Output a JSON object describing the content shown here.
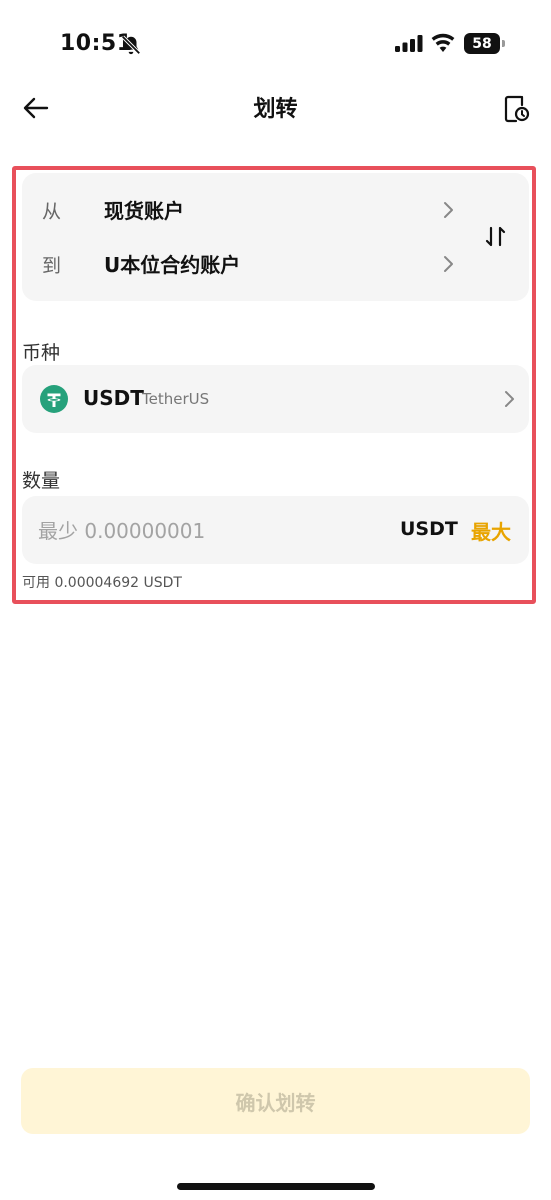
{
  "status_bar": {
    "time": "10:51",
    "battery_level": "58"
  },
  "nav": {
    "title": "划转",
    "back_icon": "arrow-left-icon",
    "history_icon": "transfer-history-icon"
  },
  "transfer": {
    "from_label": "从",
    "from_account": "现货账户",
    "to_label": "到",
    "to_account": "U本位合约账户",
    "swap_icon": "swap-vertical-icon"
  },
  "coin": {
    "section_label": "币种",
    "symbol": "USDT",
    "name": "TetherUS",
    "icon": "tether-icon"
  },
  "amount": {
    "section_label": "数量",
    "placeholder": "最少 0.00000001",
    "unit": "USDT",
    "max_label": "最大",
    "available": "可用 0.00004692 USDT"
  },
  "confirm_label": "确认划转",
  "colors": {
    "accent": "#e8a400",
    "highlight_border": "#e8505b",
    "confirm_disabled_bg": "#fff5d6",
    "tether_green": "#26a17b"
  }
}
